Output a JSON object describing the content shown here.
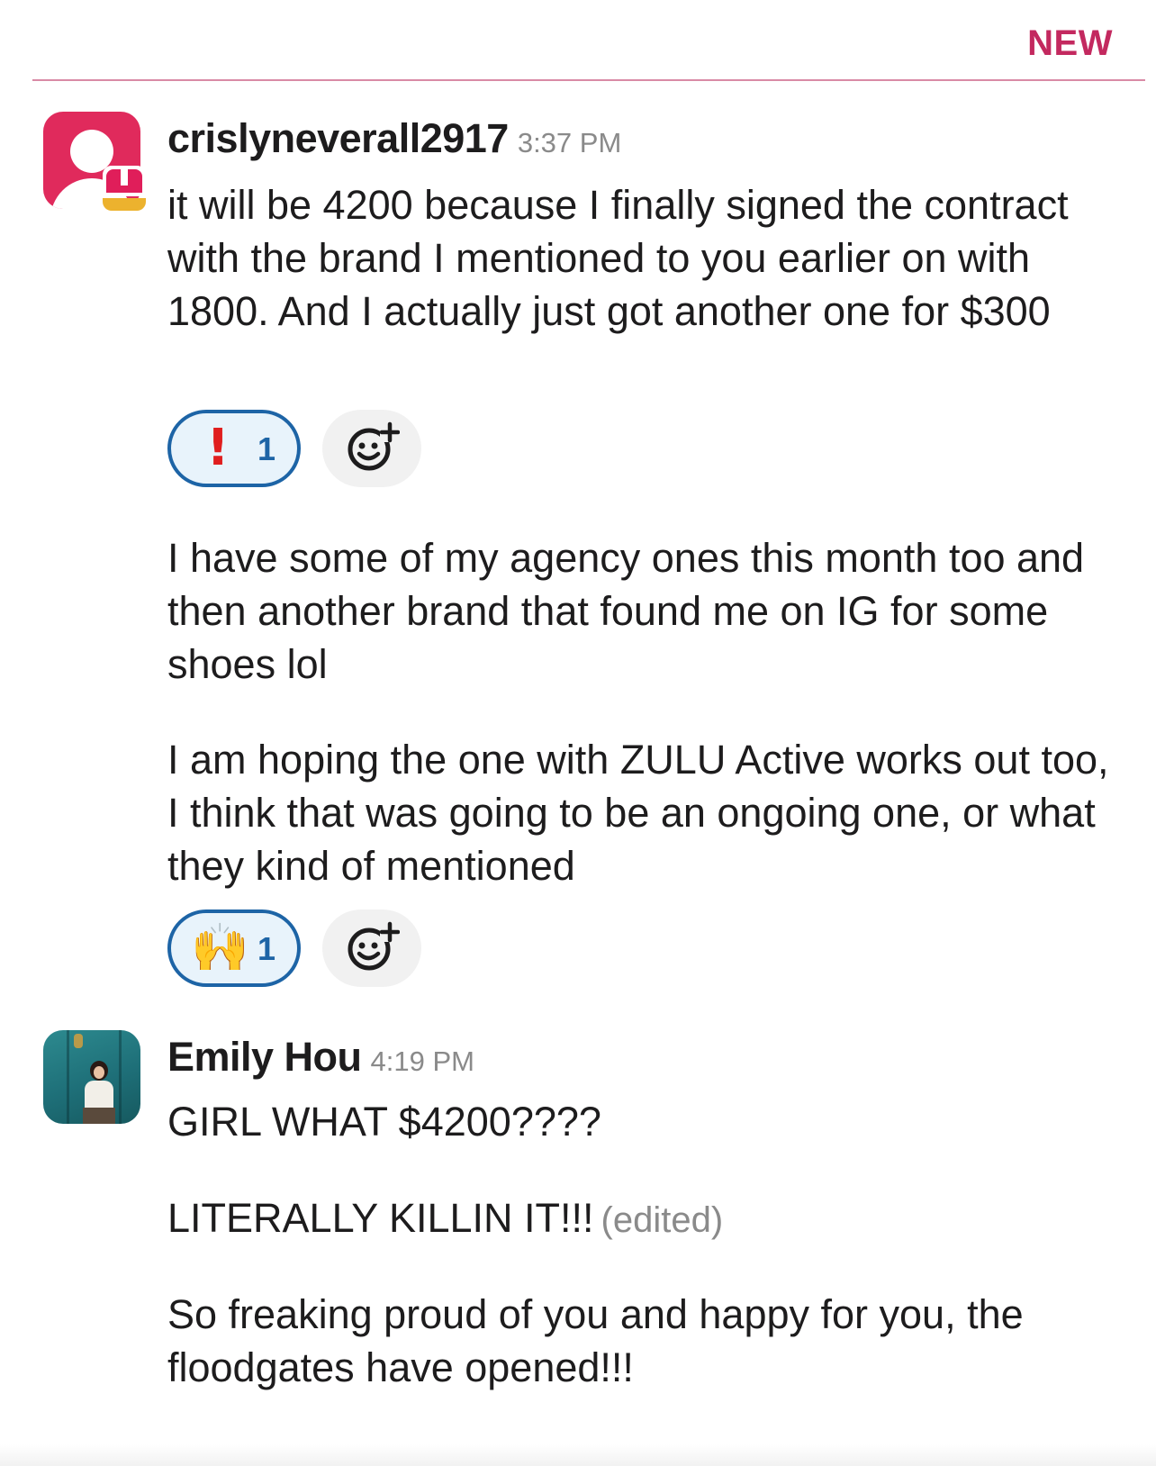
{
  "divider": {
    "label": "NEW",
    "color": "#c3295f"
  },
  "messages": [
    {
      "username": "crislyneverall2917",
      "time": "3:37 PM",
      "avatar": "default-person-avatar",
      "badge": "app-badge-icon",
      "paragraphs": [
        "it will be 4200 because I finally signed the contract with the brand I mentioned to you earlier on with 1800. And I actually just got another one for $300",
        "I have some of my agency ones this month too and then another brand that found me on IG for some shoes lol",
        "I am hoping the one with ZULU Active works out too, I think that was going to be an ongoing one, or what they kind of mentioned"
      ],
      "reactions": [
        {
          "emoji": "!",
          "emoji_name": "exclamation-icon",
          "count": "1"
        },
        {
          "emoji": "🙌",
          "emoji_name": "raised-hands-icon",
          "count": "1"
        }
      ]
    },
    {
      "username": "Emily Hou",
      "time": "4:19 PM",
      "avatar": "photo-avatar",
      "paragraphs": [
        "GIRL WHAT $4200????",
        "LITERALLY KILLIN IT!!!",
        "So freaking proud of you and happy for you, the floodgates have opened!!!"
      ],
      "edited_label": "(edited)"
    }
  ],
  "colors": {
    "reaction_border": "#1d64a6",
    "reaction_bg": "#e8f3fb",
    "text": "#1d1c1d",
    "muted": "#8a8a8a"
  }
}
